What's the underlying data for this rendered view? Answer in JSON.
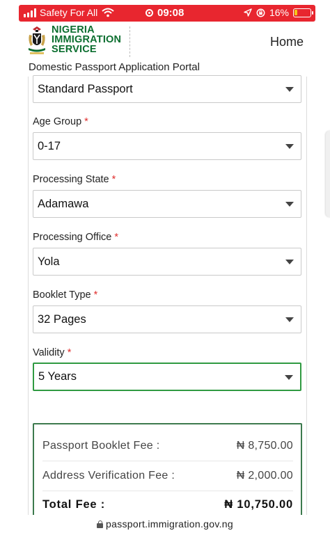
{
  "status_bar": {
    "carrier": "Safety For All",
    "time": "09:08",
    "battery_percent": "16%",
    "battery_level": 0.16,
    "icons": [
      "signal-icon",
      "wifi-icon",
      "screen-record-icon",
      "location-icon",
      "orientation-lock-icon",
      "battery-icon"
    ]
  },
  "header": {
    "logo_lines": [
      "NIGERIA",
      "IMMIGRATION",
      "SERVICE"
    ],
    "home_label": "Home",
    "portal_title": "Domestic Passport Application Portal"
  },
  "form": {
    "passport_type": {
      "value": "Standard Passport"
    },
    "age_group": {
      "label": "Age Group",
      "required_mark": "*",
      "value": "0-17"
    },
    "processing_state": {
      "label": "Processing State",
      "required_mark": "*",
      "value": "Adamawa"
    },
    "processing_office": {
      "label": "Processing Office",
      "required_mark": "*",
      "value": "Yola"
    },
    "booklet_type": {
      "label": "Booklet Type",
      "required_mark": "*",
      "value": "32 Pages"
    },
    "validity": {
      "label": "Validity",
      "required_mark": "*",
      "value": "5 Years"
    }
  },
  "fees": {
    "rows": [
      {
        "label": "Passport Booklet Fee :",
        "amount": "₦ 8,750.00"
      },
      {
        "label": "Address Verification Fee :",
        "amount": "₦ 2,000.00"
      }
    ],
    "total": {
      "label": "Total Fee :",
      "amount": "₦ 10,750.00"
    }
  },
  "url_bar": {
    "url": "passport.immigration.gov.ng"
  },
  "colors": {
    "status_bar": "#e8262f",
    "brand_green": "#0b6e2f",
    "active_border": "#2f9a41",
    "fee_box_border": "#3d7a4e",
    "required": "#e0302f"
  }
}
